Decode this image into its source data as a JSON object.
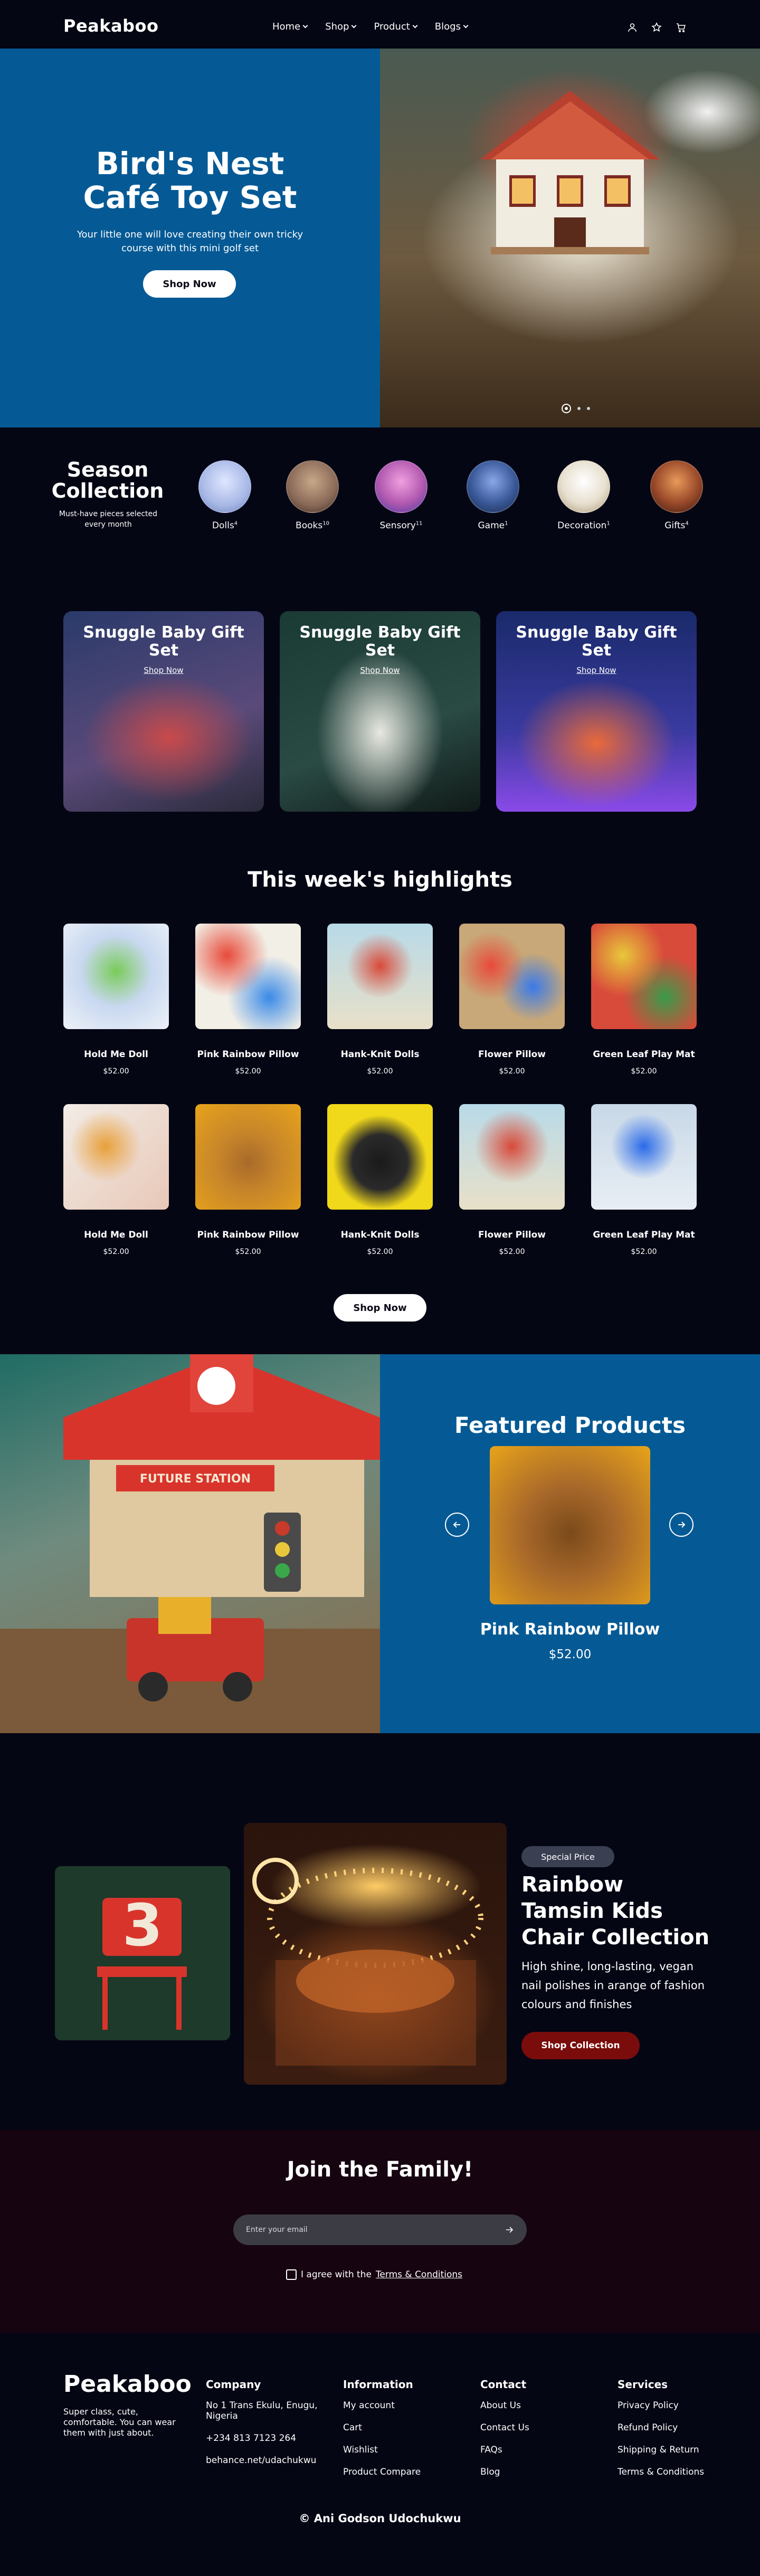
{
  "nav": {
    "logo": "Peakaboo",
    "menu": [
      {
        "label": "Home"
      },
      {
        "label": "Shop"
      },
      {
        "label": "Product"
      },
      {
        "label": "Blogs"
      }
    ]
  },
  "hero": {
    "title_line1": "Bird's Nest",
    "title_line2": "Café Toy Set",
    "subtitle": "Your little one will love creating their own tricky course with this mini golf set",
    "button": "Shop Now",
    "slides_total": 3,
    "slide_active": 1
  },
  "season": {
    "title_line1": "Season",
    "title_line2": "Collection",
    "subtitle": "Must-have pieces selected every month",
    "categories": [
      {
        "label": "Dolls",
        "count": "4",
        "color": "#a8b8e6"
      },
      {
        "label": "Books",
        "count": "10",
        "color": "#8a6a58"
      },
      {
        "label": "Sensory",
        "count": "11",
        "color": "#b35ab0"
      },
      {
        "label": "Game",
        "count": "1",
        "color": "#3b5a9a"
      },
      {
        "label": "Decoration",
        "count": "1",
        "color": "#e8e0d0"
      },
      {
        "label": "Gifts",
        "count": "4",
        "color": "#9a4a2a"
      }
    ]
  },
  "promos": [
    {
      "title": "Snuggle Baby Gift Set",
      "link": "Shop Now"
    },
    {
      "title": "Snuggle Baby Gift Set",
      "link": "Shop Now"
    },
    {
      "title": "Snuggle Baby Gift Set",
      "link": "Shop Now"
    }
  ],
  "highlights": {
    "title": "This week's highlights",
    "products": [
      {
        "name": "Hold Me Doll",
        "price": "$52.00"
      },
      {
        "name": "Pink Rainbow Pillow",
        "price": "$52.00"
      },
      {
        "name": "Hank-Knit Dolls",
        "price": "$52.00"
      },
      {
        "name": "Flower Pillow",
        "price": "$52.00"
      },
      {
        "name": "Green Leaf Play Mat",
        "price": "$52.00"
      },
      {
        "name": "Hold Me Doll",
        "price": "$52.00"
      },
      {
        "name": "Pink Rainbow Pillow",
        "price": "$52.00"
      },
      {
        "name": "Hank-Knit Dolls",
        "price": "$52.00"
      },
      {
        "name": "Flower Pillow",
        "price": "$52.00"
      },
      {
        "name": "Green Leaf Play Mat",
        "price": "$52.00"
      }
    ],
    "button": "Shop Now"
  },
  "featured": {
    "title": "Featured Products",
    "sign": "FUTURE STATION",
    "product_name": "Pink Rainbow Pillow",
    "product_price": "$52.00"
  },
  "special": {
    "badge": "Special Price",
    "chair_number": "3",
    "title": "Rainbow Tamsin Kids Chair Collection",
    "description": "High shine, long-lasting, vegan nail polishes in arange of fashion colours and finishes",
    "button": "Shop Collection"
  },
  "newsletter": {
    "title": "Join the Family!",
    "placeholder": "Enter your email",
    "agree_text": "I agree with the",
    "terms": "Terms & Conditions"
  },
  "footer": {
    "logo": "Peakaboo",
    "tagline": "Super class, cute, comfortable. You can wear them with just about.",
    "columns": [
      {
        "heading": "Company",
        "links": [
          "No 1 Trans Ekulu, Enugu, Nigeria",
          "+234 813 7123 264",
          "behance.net/udachukwu"
        ]
      },
      {
        "heading": "Information",
        "links": [
          "My account",
          "Cart",
          "Wishlist",
          "Product Compare"
        ]
      },
      {
        "heading": "Contact",
        "links": [
          "About Us",
          "Contact Us",
          "FAQs",
          "Blog"
        ]
      },
      {
        "heading": "Services",
        "links": [
          "Privacy Policy",
          "Refund Policy",
          "Shipping & Return",
          "Terms & Conditions"
        ]
      }
    ],
    "copyright": "© Ani Godson Udochukwu"
  },
  "colors": {
    "background": "#050614",
    "brand_blue": "#055a95",
    "newsletter_bg": "#160410",
    "special_button": "#7a0c0c"
  }
}
